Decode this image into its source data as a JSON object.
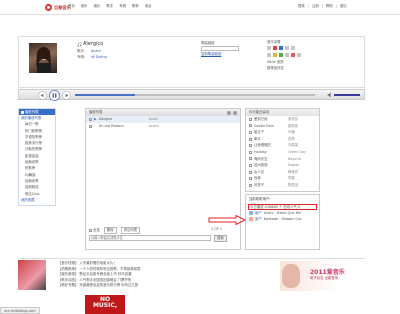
{
  "header": {
    "logo_text": "巨鲸音乐",
    "nav": [
      "首页",
      "音乐",
      "娱乐",
      "歌手",
      "专辑",
      "歌单",
      "电台"
    ],
    "right_links": [
      "登录",
      "注册",
      "帮助",
      "退出"
    ]
  },
  "now_playing": {
    "title": "Alergico",
    "artist_label": "歌手:",
    "artist": "Anahi",
    "album_label": "专辑:",
    "album": "Mi Delirio",
    "share_label": "推荐给好友",
    "link_label": "歌曲链接",
    "link_text": "复制歌曲链接",
    "right_line1": "音乐设置",
    "right_line2": "960K 音质"
  },
  "sidebar": {
    "header": "播放列表",
    "items": [
      "我的播放列表",
      "每日一歌",
      "热门新歌榜",
      "华语热歌榜",
      "欧美流行榜",
      "日韩热歌榜",
      "影视金曲",
      "经典老歌",
      "热歌榜",
      "DJ舞曲",
      "经典老歌",
      "摇滚精选",
      "夜店Club",
      "我的收藏"
    ]
  },
  "playlist": {
    "header": "播放列表",
    "rows": [
      {
        "title": "Alergico",
        "artist": "Anahi"
      },
      {
        "title": "Ni una Palabra",
        "artist": "Anahi"
      }
    ],
    "footer_buttons": [
      "全选",
      "删除",
      "清空列表"
    ],
    "page": "1 OF 1",
    "search_placeholder": "请输入歌曲名或歌手名",
    "search_button": "搜索"
  },
  "recommend": {
    "header": "你可能还喜欢",
    "items": [
      {
        "title": "爱到已经",
        "artist": "张学友"
      },
      {
        "title": "Gentle Rain",
        "artist": "茱莉亚"
      },
      {
        "title": "星空下",
        "artist": "许巍"
      },
      {
        "title": "牵手",
        "artist": "苏芮"
      },
      {
        "title": "让我慢慢的",
        "artist": "刘若英"
      },
      {
        "title": "Holiday",
        "artist": "Green Day"
      },
      {
        "title": "海阔天空",
        "artist": "Beyond"
      },
      {
        "title": "加州旅馆",
        "artist": "Eagles"
      },
      {
        "title": "女人花",
        "artist": "梅艳芳"
      },
      {
        "title": "传奇",
        "artist": "李健"
      },
      {
        "title": "好孩子",
        "artist": "陈奕迅"
      }
    ]
  },
  "listeners": {
    "header": "当前收听用户:",
    "highlight": "今日播放:236886 个 在线人气:5",
    "users": [
      {
        "user": "用户",
        "song": "Anahi - Hasta Que Me"
      },
      {
        "user": "用户",
        "song": "Kaskade - Steppin Out"
      }
    ]
  },
  "news": {
    "lines": [
      "【音乐快报】 入冬最好看的电影大片！",
      "【热歌推荐】 一个人的时候听听这首歌，不再孤单寂寞",
      "【娱乐新闻】 歌坛天后新专辑全面上市 好评如潮",
      "【歌手动态】 人气歌手全国巡回演唱会 门票开售",
      "【精彩专题】 年度最受欢迎的音乐排行榜 你听过几首"
    ],
    "ad_title": "2011爱音乐",
    "ad_sub": "电子杂志 全新登场"
  },
  "bottom_banner": {
    "line1": "NO",
    "line2": "MUSIC,"
  },
  "status_bar": {
    "url": "ure.mi4kiblog.com"
  },
  "colors": {
    "accent_blue": "#3a6ec8",
    "annotation_red": "#e02020"
  }
}
